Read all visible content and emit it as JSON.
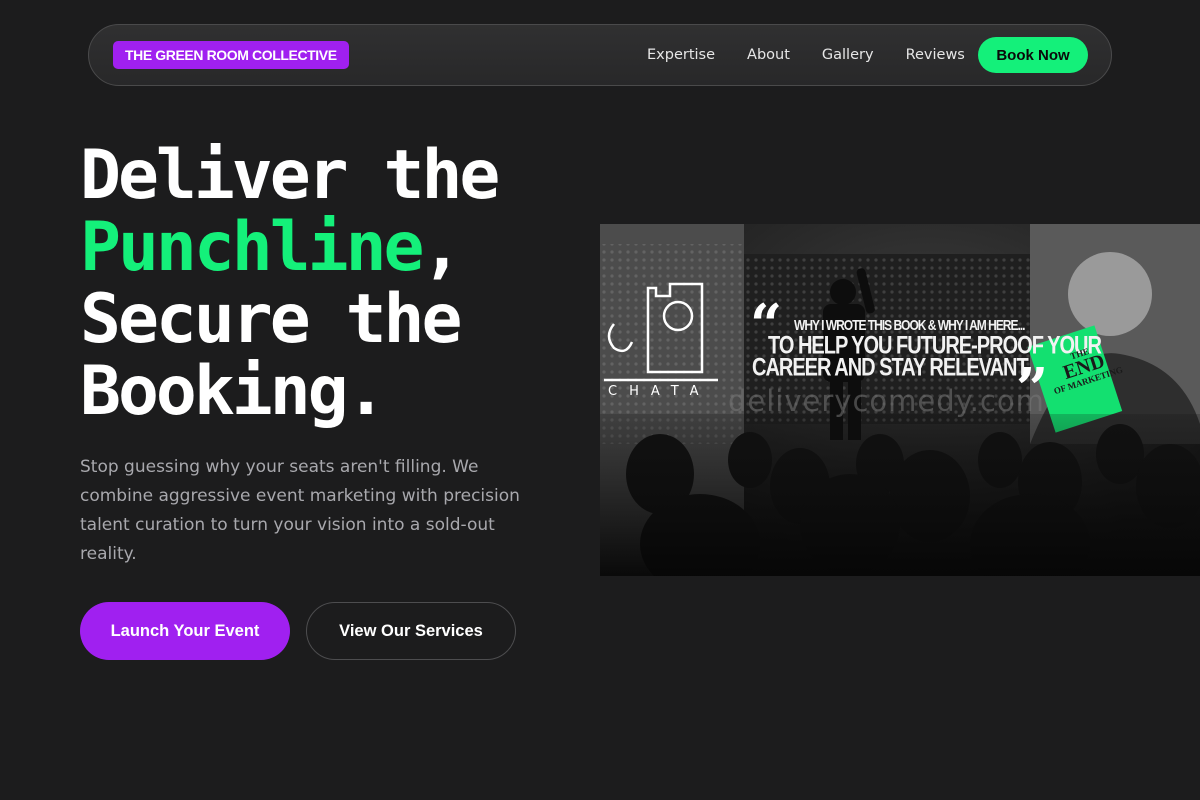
{
  "nav": {
    "brand": "THE GREEN ROOM COLLECTIVE",
    "links": [
      "Expertise",
      "About",
      "Gallery",
      "Reviews"
    ],
    "cta": "Book Now"
  },
  "hero": {
    "line1": "Deliver the",
    "line2_accent": "Punchline",
    "line2_rest": ",",
    "line3": "Secure the",
    "line4": "Booking.",
    "subtext": "Stop guessing why your seats aren't filling. We combine aggressive event marketing with precision talent curation to turn your vision into a sold-out reality.",
    "primary_cta": "Launch Your Event",
    "secondary_cta": "View Our Services"
  },
  "photo": {
    "screen_small": "WHY I WROTE THIS BOOK & WHY I AM HERE...",
    "screen_line1": "TO HELP YOU FUTURE-PROOF YOUR",
    "screen_line2": "CAREER AND STAY RELEVANT.",
    "book_title_1": "THE",
    "book_title_2": "END",
    "book_title_3": "OF MARKETING",
    "venue": "CHATA",
    "watermark": "deliverycomedy.com"
  },
  "colors": {
    "background": "#1c1c1d",
    "accent_green": "#14f07a",
    "accent_purple": "#a020f0"
  }
}
